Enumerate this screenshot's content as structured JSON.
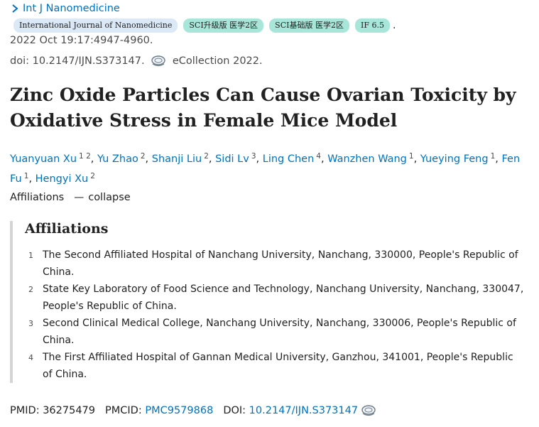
{
  "journal": {
    "name": "Int J Nanomedicine"
  },
  "badges": {
    "journal_full": "International Journal of Nanomedicine",
    "sci_upgraded": "SCI升级版 医学2区",
    "sci_basic": "SCI基础版 医学2区",
    "impact_factor": "IF 6.5",
    "trailing": "."
  },
  "citation": {
    "date_pages": "2022 Oct 19:17:4947-4960.",
    "doi_line": "doi: 10.2147/IJN.S373147.",
    "ecollection": "eCollection 2022."
  },
  "title": "Zinc Oxide Particles Can Cause Ovarian Toxicity by Oxidative Stress in Female Mice Model",
  "authors": [
    {
      "name": "Yuanyuan Xu",
      "sup": "1 2"
    },
    {
      "name": "Yu Zhao",
      "sup": "2"
    },
    {
      "name": "Shanji Liu",
      "sup": "2"
    },
    {
      "name": "Sidi Lv",
      "sup": "3"
    },
    {
      "name": "Ling Chen",
      "sup": "4"
    },
    {
      "name": "Wanzhen Wang",
      "sup": "1"
    },
    {
      "name": "Yueying Feng",
      "sup": "1"
    },
    {
      "name": "Fen Fu",
      "sup": "1"
    },
    {
      "name": "Hengyi Xu",
      "sup": "2"
    }
  ],
  "affiliations_toggle": {
    "label": "Affiliations",
    "action": "collapse"
  },
  "affiliations": {
    "heading": "Affiliations",
    "items": [
      {
        "num": "1",
        "text": "The Second Affiliated Hospital of Nanchang University, Nanchang, 330000, People's Republic of China."
      },
      {
        "num": "2",
        "text": "State Key Laboratory of Food Science and Technology, Nanchang University, Nanchang, 330047, People's Republic of China."
      },
      {
        "num": "3",
        "text": "Second Clinical Medical College, Nanchang University, Nanchang, 330006, People's Republic of China."
      },
      {
        "num": "4",
        "text": "The First Affiliated Hospital of Gannan Medical University, Ganzhou, 341001, People's Republic of China."
      }
    ]
  },
  "identifiers": {
    "pmid_label": "PMID:",
    "pmid": "36275479",
    "pmcid_label": "PMCID:",
    "pmcid": "PMC9579868",
    "doi_label": "DOI:",
    "doi": "10.2147/IJN.S373147"
  },
  "colors": {
    "link": "#0071bc",
    "badge_journal_bg": "#dbe9f7",
    "badge_sci_bg": "#a8e6d9",
    "quote_border": "#d5d5d5"
  },
  "icons": {
    "journal_chevron": "chevron-right-icon",
    "doi_link": "doi-lens-icon"
  }
}
